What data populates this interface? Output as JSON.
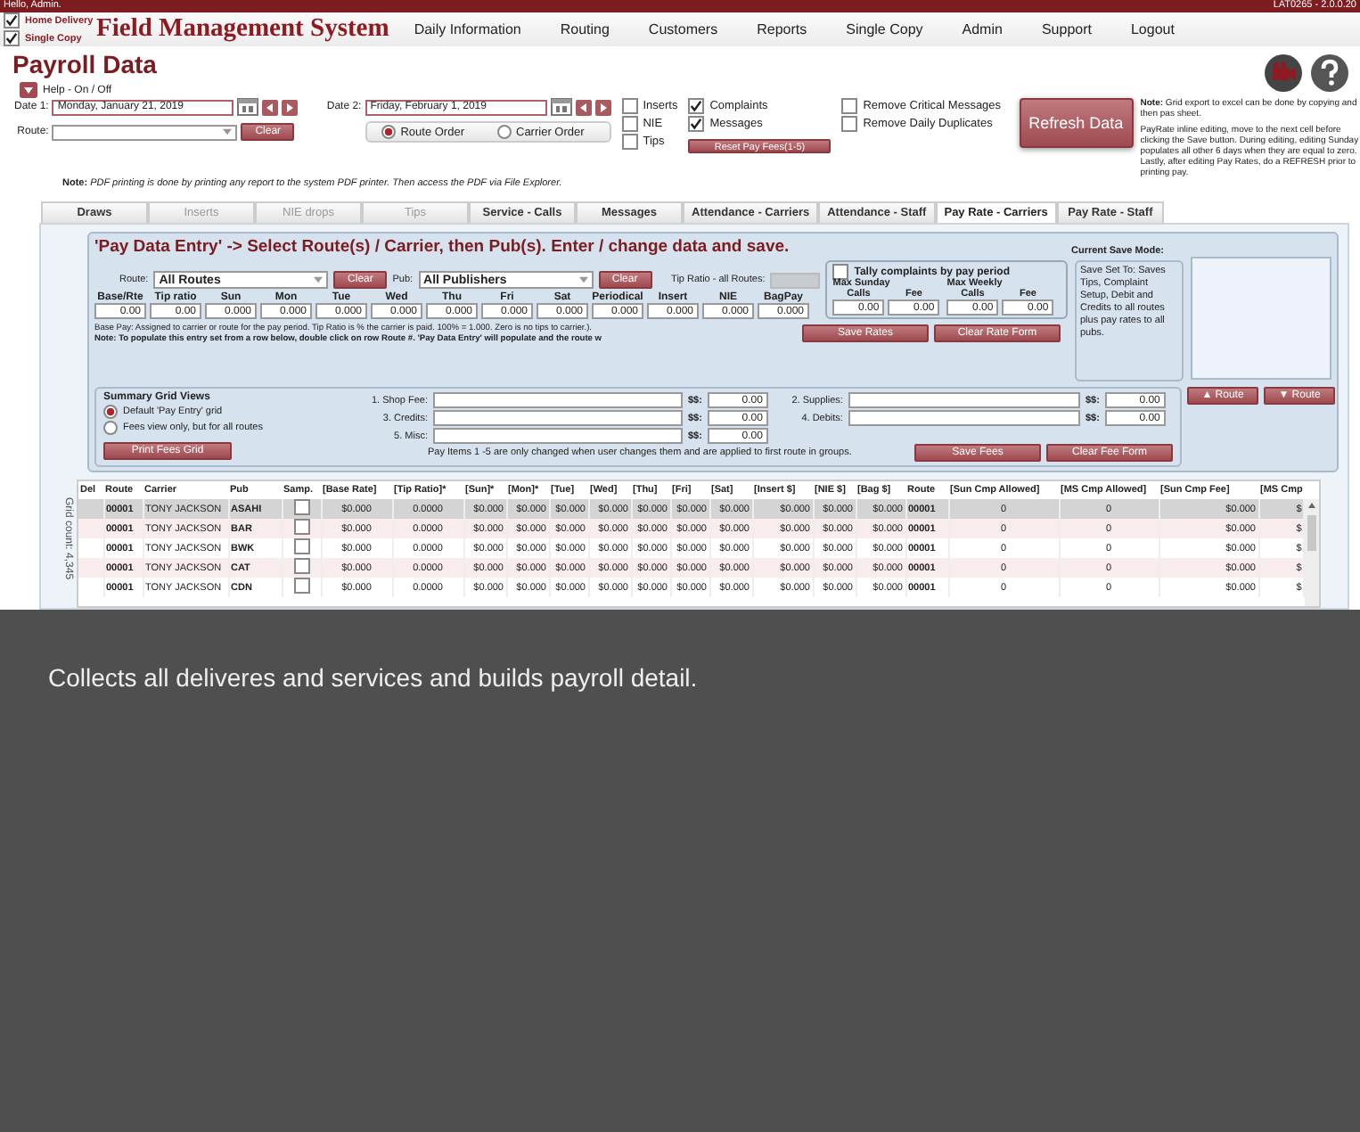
{
  "top_bar": {
    "greeting": "Hello, Admin.",
    "version": "LAT0265 - 2.0.0.20"
  },
  "header": {
    "filters": [
      {
        "label": "Home Delivery",
        "checked": true
      },
      {
        "label": "Single Copy",
        "checked": true
      }
    ],
    "title": "Field Management System",
    "menu": [
      "Daily Information",
      "Routing",
      "Customers",
      "Reports",
      "Single Copy",
      "Admin",
      "Support",
      "Logout"
    ]
  },
  "page": {
    "title": "Payroll Data",
    "help": "Help - On / Off"
  },
  "controls": {
    "date1": {
      "label": "Date 1:",
      "value": "Monday, January 21, 2019"
    },
    "date2": {
      "label": "Date 2:",
      "value": "Friday, February 1, 2019"
    },
    "route_label": "Route:",
    "clear": "Clear",
    "order": [
      {
        "label": "Route Order",
        "selected": true
      },
      {
        "label": "Carrier Order",
        "selected": false
      }
    ],
    "option_groups": [
      [
        {
          "label": "Inserts",
          "checked": false
        },
        {
          "label": "NIE",
          "checked": false
        },
        {
          "label": "Tips",
          "checked": false
        }
      ],
      [
        {
          "label": "Complaints",
          "checked": true
        },
        {
          "label": "Messages",
          "checked": true
        }
      ],
      [
        {
          "label": "Remove Critical Messages",
          "checked": false
        },
        {
          "label": "Remove Daily Duplicates",
          "checked": false
        }
      ]
    ],
    "reset_button": "Reset Pay Fees(1-5)",
    "refresh_button": "Refresh Data",
    "pdf_note": "**Note:** *PDF printing is done by printing any report to the system PDF printer.  Then access the PDF via File Explorer.*",
    "grid_note": "**Note:**  Grid export to excel can be done by copying and then pas sheet.",
    "edit_note": "PayRate inline editing, move to the next cell before clicking the Save button. During editing, editing Sunday populates all other 6 days when they are equal to zero.  Lastly, after editing Pay Rates, do a REFRESH prior to printing pay."
  },
  "tabs": [
    {
      "label": "Draws",
      "selected": false,
      "disabled": false
    },
    {
      "label": "Inserts",
      "selected": false,
      "disabled": true
    },
    {
      "label": "NIE drops",
      "selected": false,
      "disabled": true
    },
    {
      "label": "Tips",
      "selected": false,
      "disabled": true
    },
    {
      "label": "Service - Calls",
      "selected": false,
      "disabled": false
    },
    {
      "label": "Messages",
      "selected": false,
      "disabled": false
    },
    {
      "label": "Attendance - Carriers",
      "selected": false,
      "disabled": false
    },
    {
      "label": "Attendance - Staff",
      "selected": false,
      "disabled": false
    },
    {
      "label": "Pay Rate - Carriers",
      "selected": true,
      "disabled": false
    },
    {
      "label": "Pay Rate - Staff",
      "selected": false,
      "disabled": false
    }
  ],
  "entry": {
    "heading": "'Pay Data Entry' -> Select Route(s) / Carrier, then Pub(s).  Enter / change data and save.",
    "route_label": "Route:",
    "route": "All Routes",
    "pub_label": "Pub:",
    "pub": "All Publishers",
    "clear_route": "Clear",
    "clear_pub": "Clear",
    "tip_label": "Tip Ratio - all Routes:",
    "rates": [
      {
        "label": "Base/Rte",
        "value": "0.00"
      },
      {
        "label": "Tip ratio",
        "value": "0.00"
      },
      {
        "label": "Sun",
        "value": "0.000"
      },
      {
        "label": "Mon",
        "value": "0.000"
      },
      {
        "label": "Tue",
        "value": "0.000"
      },
      {
        "label": "Wed",
        "value": "0.000"
      },
      {
        "label": "Thu",
        "value": "0.000"
      },
      {
        "label": "Fri",
        "value": "0.000"
      },
      {
        "label": "Sat",
        "value": "0.000"
      },
      {
        "label": "Periodical",
        "value": "0.000"
      },
      {
        "label": "Insert",
        "value": "0.000"
      },
      {
        "label": "NIE",
        "value": "0.000"
      },
      {
        "label": "BagPay",
        "value": "0.000"
      }
    ],
    "tally": {
      "label": "Tally complaints by pay period",
      "checked": false
    },
    "caps": [
      {
        "title": "Max Sunday",
        "fields": [
          {
            "label": "Calls",
            "value": "0.00"
          },
          {
            "label": "Fee",
            "value": "0.00"
          }
        ]
      },
      {
        "title": "Max Weekly",
        "fields": [
          {
            "label": "Calls",
            "value": "0.00"
          },
          {
            "label": "Fee",
            "value": "0.00"
          }
        ]
      }
    ],
    "base_pay_note": "Base Pay: Assigned to carrier or route for the pay period. Tip Ratio is % the carrier is paid. 100% = 1.000.  Zero is no tips to carrier.).",
    "populate_note": "Note: To populate this entry set from a row below, double click on row Route #.  'Pay Data Entry' will populate and the route w",
    "save_rates": "Save Rates",
    "clear_rate": "Clear Rate Form",
    "save_mode_title": "Current Save Mode:",
    "save_mode": "Save Set To: Saves Tips, Complaint Setup, Debit and Credits to all routes plus pay rates to all pubs.",
    "route_up": "▲ Route",
    "route_down": "▼ Route"
  },
  "summary": {
    "title": "Summary Grid Views",
    "views": [
      {
        "label": "Default 'Pay Entry' grid",
        "selected": true
      },
      {
        "label": "Fees view only, but for all routes",
        "selected": false
      }
    ],
    "print": "Print Fees Grid",
    "fees_left": [
      {
        "label": "1. Shop Fee:",
        "currency": "$$:",
        "amount": "0.00"
      },
      {
        "label": "3. Credits:",
        "currency": "$$:",
        "amount": "0.00"
      },
      {
        "label": "5. Misc:",
        "currency": "$$:",
        "amount": "0.00"
      }
    ],
    "fees_right": [
      {
        "label": "2. Supplies:",
        "currency": "$$:",
        "amount": "0.00"
      },
      {
        "label": "4. Debits:",
        "currency": "$$:",
        "amount": "0.00"
      }
    ],
    "fees_note": "Pay Items 1 -5 are only changed when user changes them and are applied to first route in groups.",
    "save_fees": "Save Fees",
    "clear_fee": "Clear Fee Form"
  },
  "grid": {
    "count": "Grid count: 4,345",
    "columns": [
      "Del",
      "Route",
      "Carrier",
      "Pub",
      "Samp.",
      "[Base Rate]",
      "[Tip Ratio]*",
      "[Sun]*",
      "[Mon]*",
      "[Tue]",
      "[Wed]",
      "[Thu]",
      "[Fri]",
      "[Sat]",
      "[Insert $]",
      "[NIE $]",
      "[Bag $]",
      "Route",
      "[Sun Cmp Allowed]",
      "[MS Cmp Allowed]",
      "[Sun Cmp Fee]",
      "[MS Cmp"
    ],
    "rows": [
      {
        "selected": true,
        "route": "00001",
        "carrier": "TONY JACKSON",
        "pub": "ASAHI",
        "sample": false,
        "values": [
          "$0.000",
          "0.0000",
          "$0.000",
          "$0.000",
          "$0.000",
          "$0.000",
          "$0.000",
          "$0.000",
          "$0.000",
          "$0.000",
          "$0.000",
          "$0.000"
        ],
        "route2": "00001",
        "tail": [
          "0",
          "0",
          "$0.000",
          "$"
        ]
      },
      {
        "selected": false,
        "route": "00001",
        "carrier": "TONY JACKSON",
        "pub": "BAR",
        "sample": false,
        "values": [
          "$0.000",
          "0.0000",
          "$0.000",
          "$0.000",
          "$0.000",
          "$0.000",
          "$0.000",
          "$0.000",
          "$0.000",
          "$0.000",
          "$0.000",
          "$0.000"
        ],
        "route2": "00001",
        "tail": [
          "0",
          "0",
          "$0.000",
          "$"
        ]
      },
      {
        "selected": false,
        "route": "00001",
        "carrier": "TONY JACKSON",
        "pub": "BWK",
        "sample": false,
        "values": [
          "$0.000",
          "0.0000",
          "$0.000",
          "$0.000",
          "$0.000",
          "$0.000",
          "$0.000",
          "$0.000",
          "$0.000",
          "$0.000",
          "$0.000",
          "$0.000"
        ],
        "route2": "00001",
        "tail": [
          "0",
          "0",
          "$0.000",
          "$"
        ]
      },
      {
        "selected": false,
        "route": "00001",
        "carrier": "TONY JACKSON",
        "pub": "CAT",
        "sample": false,
        "values": [
          "$0.000",
          "0.0000",
          "$0.000",
          "$0.000",
          "$0.000",
          "$0.000",
          "$0.000",
          "$0.000",
          "$0.000",
          "$0.000",
          "$0.000",
          "$0.000"
        ],
        "route2": "00001",
        "tail": [
          "0",
          "0",
          "$0.000",
          "$"
        ]
      },
      {
        "selected": false,
        "route": "00001",
        "carrier": "TONY JACKSON",
        "pub": "CDN",
        "sample": false,
        "values": [
          "$0.000",
          "0.0000",
          "$0.000",
          "$0.000",
          "$0.000",
          "$0.000",
          "$0.000",
          "$0.000",
          "$0.000",
          "$0.000",
          "$0.000",
          "$0.000"
        ],
        "route2": "00001",
        "tail": [
          "0",
          "0",
          "$0.000",
          "$"
        ]
      }
    ]
  },
  "caption": "Collects all deliveres and services and builds payroll detail."
}
